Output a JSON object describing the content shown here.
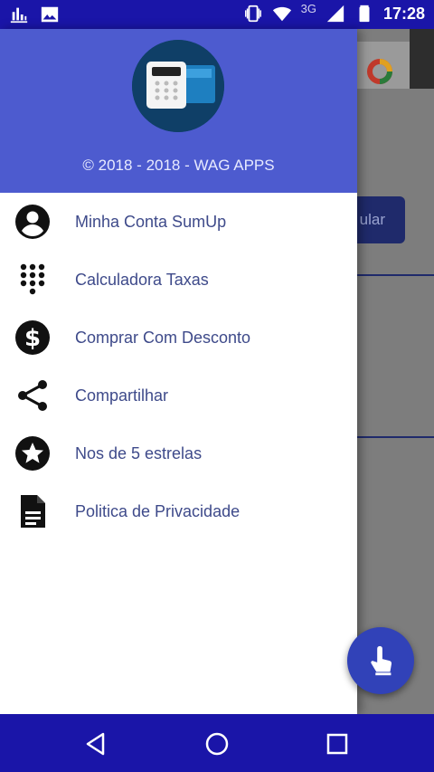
{
  "status_bar": {
    "time": "17:28",
    "network": "3G",
    "left_icons": [
      "stats-icon",
      "image-icon"
    ],
    "right_icons": [
      "vibrate-icon",
      "wifi-icon",
      "signal-icon",
      "battery-icon"
    ]
  },
  "drawer": {
    "header": {
      "caption": "© 2018 - 2018 - WAG APPS",
      "background": "#4d5bcf"
    },
    "items": [
      {
        "label": "Minha Conta SumUp",
        "icon": "account-circle-icon"
      },
      {
        "label": "Calculadora Taxas",
        "icon": "dialpad-icon"
      },
      {
        "label": "Comprar Com Desconto",
        "icon": "dollar-circle-icon"
      },
      {
        "label": "Compartilhar",
        "icon": "share-icon"
      },
      {
        "label": "Nos de 5 estrelas",
        "icon": "star-circle-icon"
      },
      {
        "label": "Politica de Privacidade",
        "icon": "document-icon"
      }
    ]
  },
  "background_app": {
    "button_text": "ular"
  },
  "colors": {
    "primary_dark": "#1a15a8",
    "accent": "#3142b8",
    "menu_text": "#3e4a8a"
  }
}
